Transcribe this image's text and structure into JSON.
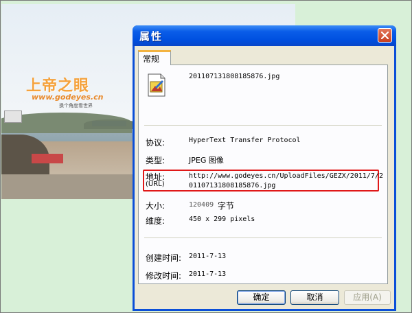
{
  "watermark": {
    "title": "上帝之眼",
    "url": "www.godeyes.cn",
    "subtitle": "换个角度看世界"
  },
  "dialog": {
    "title": "属性",
    "tab_label": "常规",
    "file_name": "20110713180818587​6.jpg",
    "fields": {
      "protocol_label": "协议:",
      "protocol_value": "HyperText Transfer Protocol",
      "type_label": "类型:",
      "type_value": "JPEG 图像",
      "address_label": "地址:",
      "address_label2": "(URL)",
      "address_value_line1": "http://www.godeyes.cn/UploadFiles/GEZX/2011/7/2",
      "address_value_line2": "0110713180818587​6.jpg",
      "size_label": "大小:",
      "size_value": "120409",
      "size_unit": "字节",
      "dimension_label": "维度:",
      "dimension_value": "450  x  299  pixels",
      "created_label": "创建时间:",
      "created_value": "2011-7-13",
      "modified_label": "修改时间:",
      "modified_value": "2011-7-13"
    },
    "buttons": {
      "ok": "确定",
      "cancel": "取消",
      "apply": "应用(A)"
    }
  }
}
